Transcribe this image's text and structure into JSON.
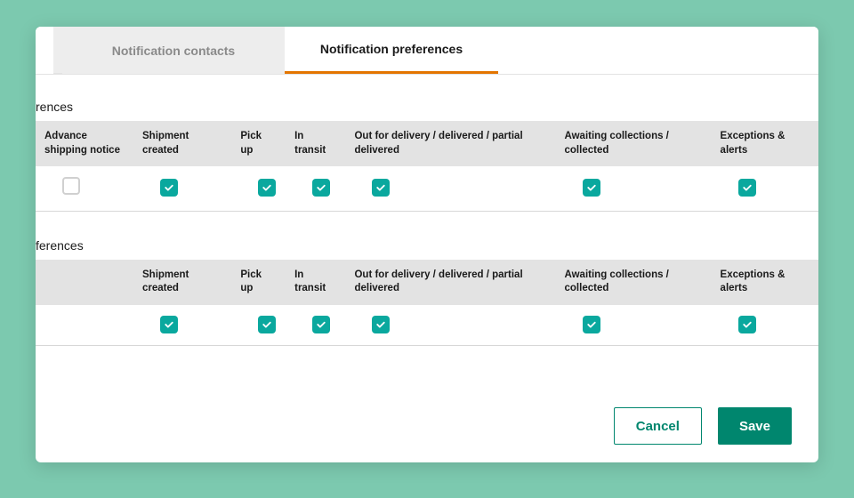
{
  "tabs": {
    "contacts": "Notification contacts",
    "preferences": "Notification preferences"
  },
  "section1": {
    "title_fragment": "rences",
    "headers": [
      "Advance shipping notice",
      "Shipment created",
      "Pick up",
      "In transit",
      "Out for delivery / delivered / partial delivered",
      "Awaiting collections / collected",
      "Exceptions & alerts"
    ],
    "checks": [
      false,
      true,
      true,
      true,
      true,
      true,
      true
    ]
  },
  "section2": {
    "title_fragment": "ferences",
    "headers": [
      "",
      "Shipment created",
      "Pick up",
      "In transit",
      "Out for delivery / delivered / partial delivered",
      "Awaiting collections / collected",
      "Exceptions & alerts"
    ],
    "checks": [
      null,
      true,
      true,
      true,
      true,
      true,
      true
    ]
  },
  "footer": {
    "cancel": "Cancel",
    "save": "Save"
  },
  "colors": {
    "accent": "#0aa89e",
    "primary": "#00866e",
    "tab_underline": "#e37500"
  }
}
